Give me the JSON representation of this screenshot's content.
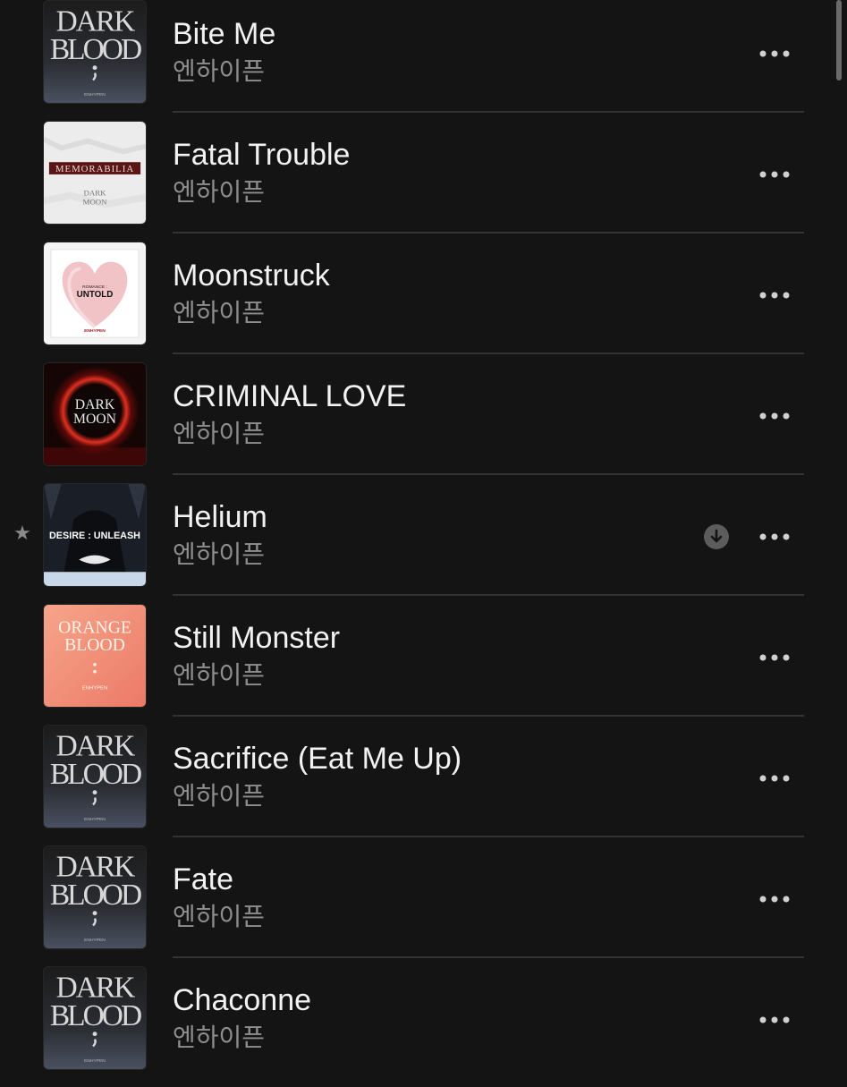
{
  "tracks": [
    {
      "title": "Bite Me",
      "artist": "엔하이픈",
      "art": "dark-blood"
    },
    {
      "title": "Fatal Trouble",
      "artist": "엔하이픈",
      "art": "memorabilia"
    },
    {
      "title": "Moonstruck",
      "artist": "엔하이픈",
      "art": "romance-untold"
    },
    {
      "title": "CRIMINAL LOVE",
      "artist": "엔하이픈",
      "art": "dark-moon"
    },
    {
      "title": "Helium",
      "artist": "엔하이픈",
      "art": "desire-unleash",
      "favorite": true,
      "downloaded": true
    },
    {
      "title": "Still Monster",
      "artist": "엔하이픈",
      "art": "orange-blood"
    },
    {
      "title": "Sacrifice (Eat Me Up)",
      "artist": "엔하이픈",
      "art": "dark-blood"
    },
    {
      "title": "Fate",
      "artist": "엔하이픈",
      "art": "dark-blood"
    },
    {
      "title": "Chaconne",
      "artist": "엔하이픈",
      "art": "dark-blood"
    }
  ],
  "art_text": {
    "dark_blood_1": "DARK",
    "dark_blood_2": "BLOOD",
    "dark_blood_sub": "ENHYPEN",
    "memorabilia": "MEMORABILIA",
    "dark_moon_1": "DARK",
    "dark_moon_2": "MOON",
    "romance": "ROMANCE :",
    "untold": "UNTOLD",
    "untold_sub": "ENHYPEN",
    "desire_unleash": "DESIRE : UNLEASH",
    "orange_1": "ORANGE",
    "orange_2": "BLOOD",
    "orange_sub": "ENHYPEN"
  },
  "icons": {
    "favorite": "star-icon",
    "download": "download-icon",
    "more": "more-icon"
  },
  "colors": {
    "background": "#141414",
    "title": "#f2f2f2",
    "subtitle": "#8e8e8e",
    "separator": "#333333"
  }
}
